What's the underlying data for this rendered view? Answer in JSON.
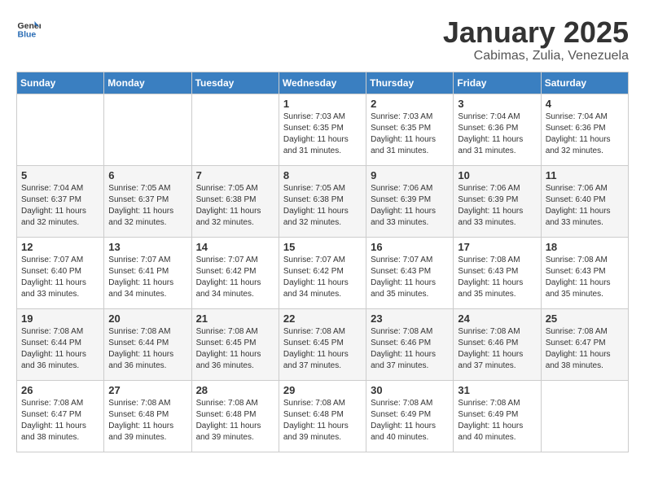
{
  "logo": {
    "text_general": "General",
    "text_blue": "Blue"
  },
  "title": {
    "month_year": "January 2025",
    "location": "Cabimas, Zulia, Venezuela"
  },
  "headers": [
    "Sunday",
    "Monday",
    "Tuesday",
    "Wednesday",
    "Thursday",
    "Friday",
    "Saturday"
  ],
  "weeks": [
    [
      {
        "day": "",
        "sunrise": "",
        "sunset": "",
        "daylight": ""
      },
      {
        "day": "",
        "sunrise": "",
        "sunset": "",
        "daylight": ""
      },
      {
        "day": "",
        "sunrise": "",
        "sunset": "",
        "daylight": ""
      },
      {
        "day": "1",
        "sunrise": "Sunrise: 7:03 AM",
        "sunset": "Sunset: 6:35 PM",
        "daylight": "Daylight: 11 hours and 31 minutes."
      },
      {
        "day": "2",
        "sunrise": "Sunrise: 7:03 AM",
        "sunset": "Sunset: 6:35 PM",
        "daylight": "Daylight: 11 hours and 31 minutes."
      },
      {
        "day": "3",
        "sunrise": "Sunrise: 7:04 AM",
        "sunset": "Sunset: 6:36 PM",
        "daylight": "Daylight: 11 hours and 31 minutes."
      },
      {
        "day": "4",
        "sunrise": "Sunrise: 7:04 AM",
        "sunset": "Sunset: 6:36 PM",
        "daylight": "Daylight: 11 hours and 32 minutes."
      }
    ],
    [
      {
        "day": "5",
        "sunrise": "Sunrise: 7:04 AM",
        "sunset": "Sunset: 6:37 PM",
        "daylight": "Daylight: 11 hours and 32 minutes."
      },
      {
        "day": "6",
        "sunrise": "Sunrise: 7:05 AM",
        "sunset": "Sunset: 6:37 PM",
        "daylight": "Daylight: 11 hours and 32 minutes."
      },
      {
        "day": "7",
        "sunrise": "Sunrise: 7:05 AM",
        "sunset": "Sunset: 6:38 PM",
        "daylight": "Daylight: 11 hours and 32 minutes."
      },
      {
        "day": "8",
        "sunrise": "Sunrise: 7:05 AM",
        "sunset": "Sunset: 6:38 PM",
        "daylight": "Daylight: 11 hours and 32 minutes."
      },
      {
        "day": "9",
        "sunrise": "Sunrise: 7:06 AM",
        "sunset": "Sunset: 6:39 PM",
        "daylight": "Daylight: 11 hours and 33 minutes."
      },
      {
        "day": "10",
        "sunrise": "Sunrise: 7:06 AM",
        "sunset": "Sunset: 6:39 PM",
        "daylight": "Daylight: 11 hours and 33 minutes."
      },
      {
        "day": "11",
        "sunrise": "Sunrise: 7:06 AM",
        "sunset": "Sunset: 6:40 PM",
        "daylight": "Daylight: 11 hours and 33 minutes."
      }
    ],
    [
      {
        "day": "12",
        "sunrise": "Sunrise: 7:07 AM",
        "sunset": "Sunset: 6:40 PM",
        "daylight": "Daylight: 11 hours and 33 minutes."
      },
      {
        "day": "13",
        "sunrise": "Sunrise: 7:07 AM",
        "sunset": "Sunset: 6:41 PM",
        "daylight": "Daylight: 11 hours and 34 minutes."
      },
      {
        "day": "14",
        "sunrise": "Sunrise: 7:07 AM",
        "sunset": "Sunset: 6:42 PM",
        "daylight": "Daylight: 11 hours and 34 minutes."
      },
      {
        "day": "15",
        "sunrise": "Sunrise: 7:07 AM",
        "sunset": "Sunset: 6:42 PM",
        "daylight": "Daylight: 11 hours and 34 minutes."
      },
      {
        "day": "16",
        "sunrise": "Sunrise: 7:07 AM",
        "sunset": "Sunset: 6:43 PM",
        "daylight": "Daylight: 11 hours and 35 minutes."
      },
      {
        "day": "17",
        "sunrise": "Sunrise: 7:08 AM",
        "sunset": "Sunset: 6:43 PM",
        "daylight": "Daylight: 11 hours and 35 minutes."
      },
      {
        "day": "18",
        "sunrise": "Sunrise: 7:08 AM",
        "sunset": "Sunset: 6:43 PM",
        "daylight": "Daylight: 11 hours and 35 minutes."
      }
    ],
    [
      {
        "day": "19",
        "sunrise": "Sunrise: 7:08 AM",
        "sunset": "Sunset: 6:44 PM",
        "daylight": "Daylight: 11 hours and 36 minutes."
      },
      {
        "day": "20",
        "sunrise": "Sunrise: 7:08 AM",
        "sunset": "Sunset: 6:44 PM",
        "daylight": "Daylight: 11 hours and 36 minutes."
      },
      {
        "day": "21",
        "sunrise": "Sunrise: 7:08 AM",
        "sunset": "Sunset: 6:45 PM",
        "daylight": "Daylight: 11 hours and 36 minutes."
      },
      {
        "day": "22",
        "sunrise": "Sunrise: 7:08 AM",
        "sunset": "Sunset: 6:45 PM",
        "daylight": "Daylight: 11 hours and 37 minutes."
      },
      {
        "day": "23",
        "sunrise": "Sunrise: 7:08 AM",
        "sunset": "Sunset: 6:46 PM",
        "daylight": "Daylight: 11 hours and 37 minutes."
      },
      {
        "day": "24",
        "sunrise": "Sunrise: 7:08 AM",
        "sunset": "Sunset: 6:46 PM",
        "daylight": "Daylight: 11 hours and 37 minutes."
      },
      {
        "day": "25",
        "sunrise": "Sunrise: 7:08 AM",
        "sunset": "Sunset: 6:47 PM",
        "daylight": "Daylight: 11 hours and 38 minutes."
      }
    ],
    [
      {
        "day": "26",
        "sunrise": "Sunrise: 7:08 AM",
        "sunset": "Sunset: 6:47 PM",
        "daylight": "Daylight: 11 hours and 38 minutes."
      },
      {
        "day": "27",
        "sunrise": "Sunrise: 7:08 AM",
        "sunset": "Sunset: 6:48 PM",
        "daylight": "Daylight: 11 hours and 39 minutes."
      },
      {
        "day": "28",
        "sunrise": "Sunrise: 7:08 AM",
        "sunset": "Sunset: 6:48 PM",
        "daylight": "Daylight: 11 hours and 39 minutes."
      },
      {
        "day": "29",
        "sunrise": "Sunrise: 7:08 AM",
        "sunset": "Sunset: 6:48 PM",
        "daylight": "Daylight: 11 hours and 39 minutes."
      },
      {
        "day": "30",
        "sunrise": "Sunrise: 7:08 AM",
        "sunset": "Sunset: 6:49 PM",
        "daylight": "Daylight: 11 hours and 40 minutes."
      },
      {
        "day": "31",
        "sunrise": "Sunrise: 7:08 AM",
        "sunset": "Sunset: 6:49 PM",
        "daylight": "Daylight: 11 hours and 40 minutes."
      },
      {
        "day": "",
        "sunrise": "",
        "sunset": "",
        "daylight": ""
      }
    ]
  ]
}
